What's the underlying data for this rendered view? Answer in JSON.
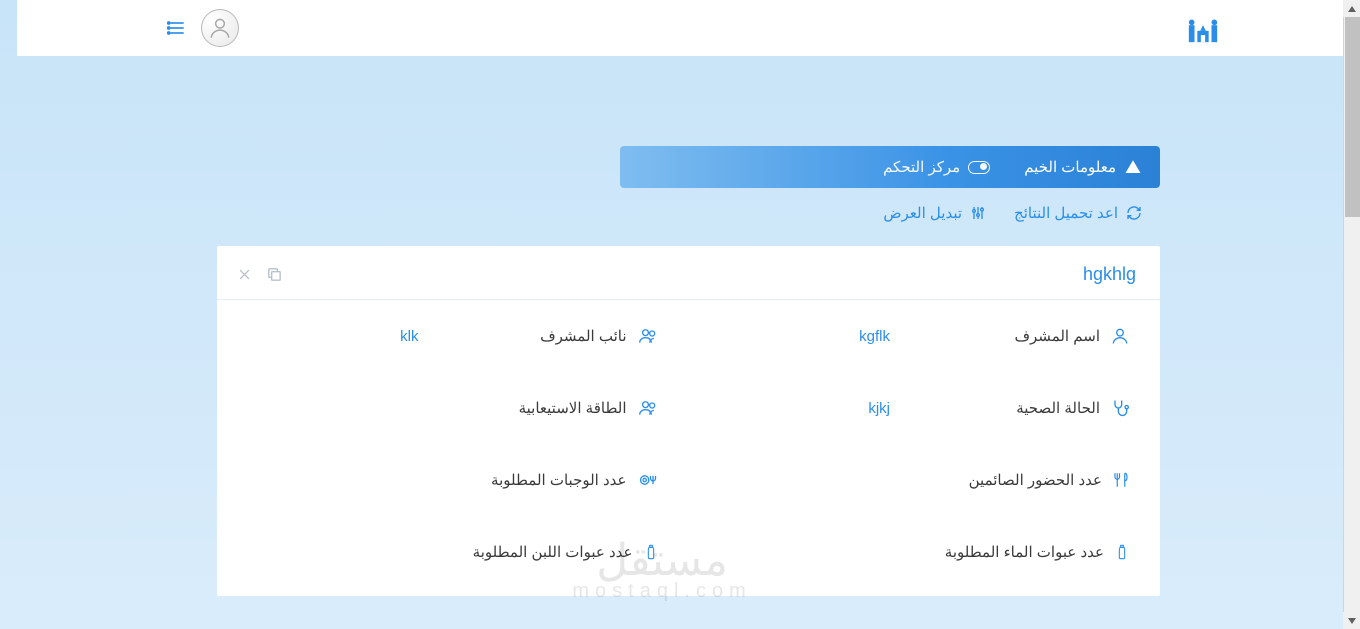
{
  "tabs": {
    "main": "معلومات الخيم",
    "secondary": "مركز التحكم"
  },
  "actions": {
    "reload": "اعد تحميل النتائج",
    "toggle_view": "تبديل العرض"
  },
  "card": {
    "title": "hgkhlg"
  },
  "fields": {
    "supervisor_name": {
      "label": "اسم المشرف",
      "value": "kgflk"
    },
    "deputy_supervisor": {
      "label": "نائب المشرف",
      "value": "klk"
    },
    "health_status": {
      "label": "الحالة الصحية",
      "value": "kjkj"
    },
    "capacity": {
      "label": "الطاقة الاستيعابية",
      "value": ""
    },
    "fasting_attendance": {
      "label": "عدد الحضور الصائمين",
      "value": ""
    },
    "meals_required": {
      "label": "عدد الوجبات المطلوبة",
      "value": ""
    },
    "water_bottles": {
      "label": "عدد عبوات الماء المطلوبة",
      "value": ""
    },
    "milk_bottles": {
      "label": "عدد عبوات اللبن المطلوبة",
      "value": ""
    }
  },
  "watermark": {
    "ar": "مستقل",
    "en": "mostaql.com"
  }
}
